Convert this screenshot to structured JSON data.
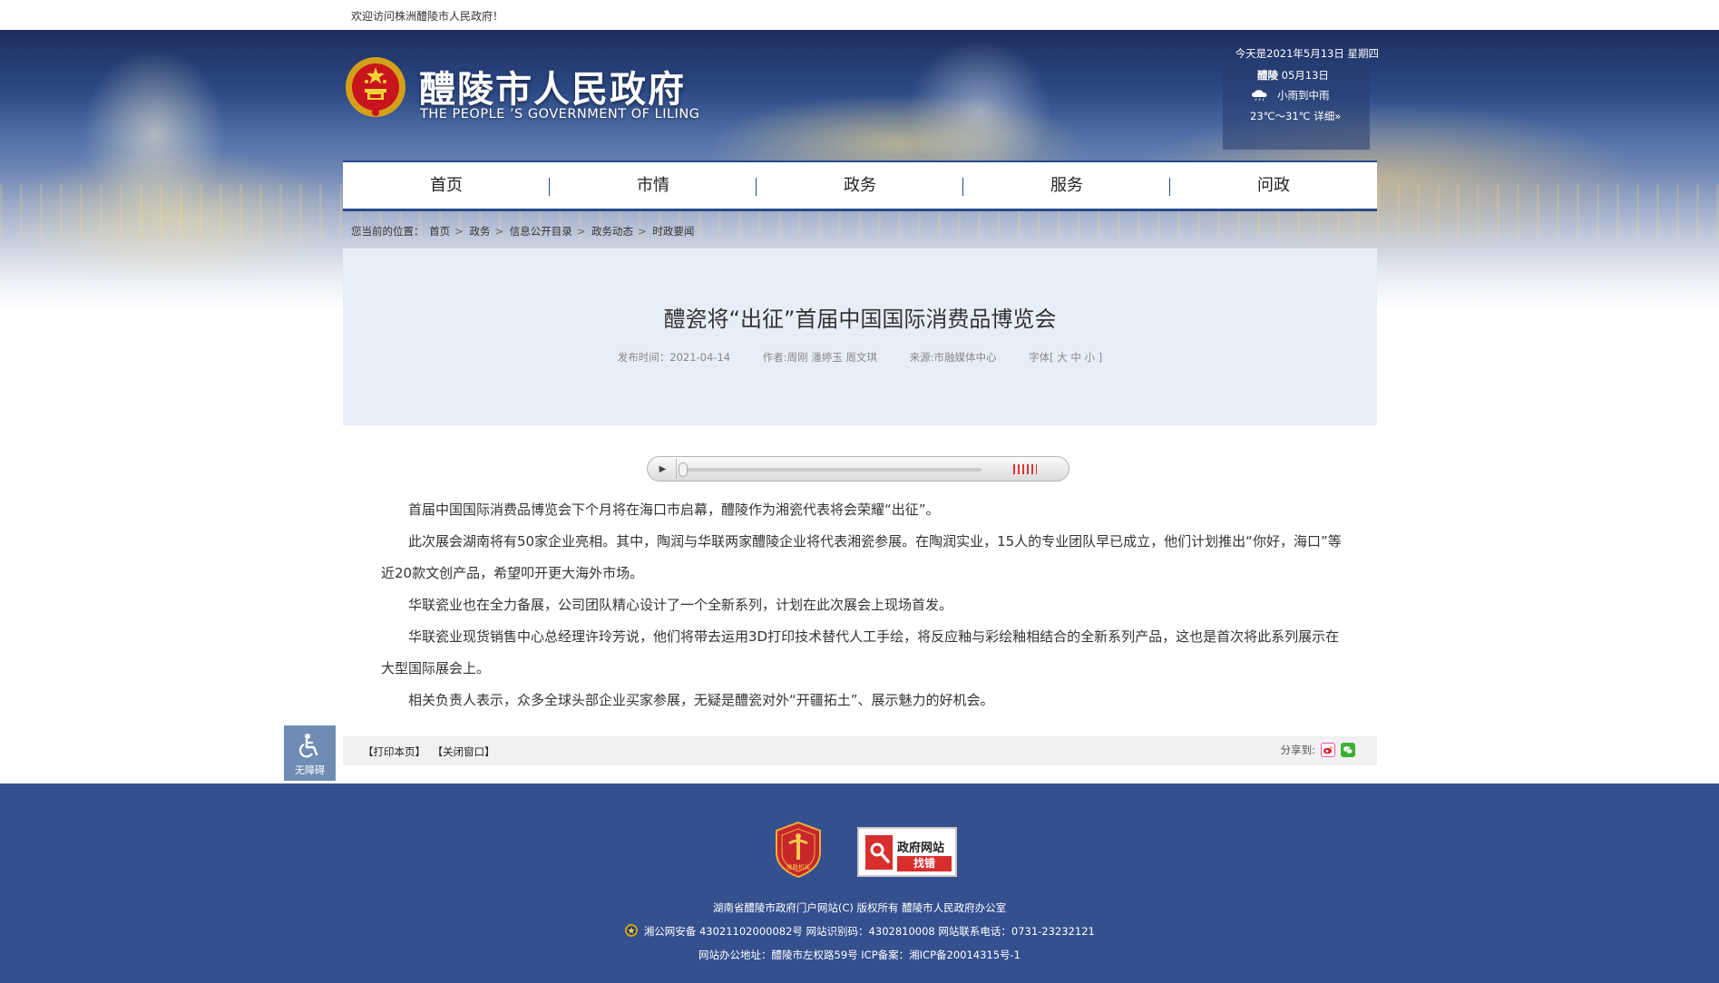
{
  "topbar": {
    "welcome": "欢迎访问株洲醴陵市人民政府！"
  },
  "header": {
    "site_title": "醴陵市人民政府",
    "site_subtitle": "THE PEOPLE ’S GOVERNMENT OF LILING",
    "date": "今天是2021年5月13日 星期四",
    "weather": {
      "city": "醴陵",
      "day": "05月13日",
      "condition": "小雨到中雨",
      "temp": "23℃～31℃",
      "detail_link": "详细»",
      "icon": "rain-cloud-icon"
    }
  },
  "nav": {
    "items": [
      "首页",
      "市情",
      "政务",
      "服务",
      "问政"
    ]
  },
  "breadcrumb": {
    "prefix": "您当前的位置：",
    "items": [
      "首页",
      "政务",
      "信息公开目录",
      "政务动态",
      "时政要闻"
    ]
  },
  "article": {
    "title": "醴瓷将“出征”首届中国国际消费品博览会",
    "publish_time": "发布时间：2021-04-14",
    "author": "作者:周刚 潘婷玉 周文琪",
    "source": "来源:市融媒体中心",
    "font_size": "字体[ 大 中 小 ]",
    "paragraphs": [
      "首届中国国际消费品博览会下个月将在海口市启幕，醴陵作为湘瓷代表将会荣耀“出征”。",
      "此次展会湖南将有50家企业亮相。其中，陶润与华联两家醴陵企业将代表湘瓷参展。在陶润实业，15人的专业团队早已成立，他们计划推出“你好，海口”等近20款文创产品，希望叩开更大海外市场。",
      "华联瓷业也在全力备展，公司团队精心设计了一个全新系列，计划在此次展会上现场首发。",
      "华联瓷业现货销售中心总经理许玲芳说，他们将带去运用3D打印技术替代人工手绘，将反应釉与彩绘釉相结合的全新系列产品，这也是首次将此系列展示在大型国际展会上。",
      "相关负责人表示，众多全球头部企业买家参展，无疑是醴瓷对外“开疆拓土”、展示魅力的好机会。"
    ]
  },
  "audio_player": {
    "play_icon": "play-icon",
    "progress": 0,
    "volume": 0.7
  },
  "accessibility": {
    "label": "无障碍",
    "icon": "wheelchair-icon"
  },
  "tools": {
    "print": "【打印本页】",
    "close": "【关闭窗口】",
    "share_label": "分享到:",
    "share_icons": [
      "weibo-icon",
      "wechat-icon"
    ]
  },
  "footer": {
    "badge_party_label": "党政机关",
    "badge_error_top": "政府网站",
    "badge_error_bottom": "找错",
    "copyright": "湖南省醴陵市政府门户网站(C) 版权所有 醴陵市人民政府办公室",
    "record": "湘公网安备 43021102000082号 网站识别码：4302810008 网站联系电话：0731-23232121",
    "address": "网站办公地址：醴陵市左权路59号   ICP备案：湘ICP备20014315号-1"
  },
  "colors": {
    "nav_border": "#2a4a8a",
    "article_head_bg": "#e7eef8",
    "footer_bg": "#34508f",
    "accessibility_bg": "#6f8db4"
  }
}
